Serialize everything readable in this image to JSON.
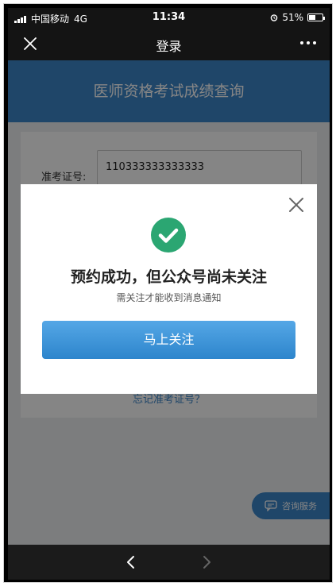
{
  "status_bar": {
    "carrier": "中国移动",
    "network": "4G",
    "time": "11:34",
    "battery_text": "51%",
    "battery_level": 0.51
  },
  "nav": {
    "title": "登录",
    "close_icon": "close-icon",
    "more_icon": "more-dots-icon"
  },
  "page": {
    "banner_title": "医师资格考试成绩查询",
    "field_label": "准考证号:",
    "field_value": "110333333333333",
    "help_link": "忘记准考证号？",
    "consult_label": "咨询服务"
  },
  "modal": {
    "title": "预约成功，但公众号尚未关注",
    "subtitle": "需关注才能收到消息通知",
    "button_label": "马上关注",
    "icon": "check-circle-icon",
    "accent_color": "#2ba672"
  },
  "bottom_bar": {
    "back_icon": "chevron-left-icon",
    "forward_icon": "chevron-right-icon"
  }
}
